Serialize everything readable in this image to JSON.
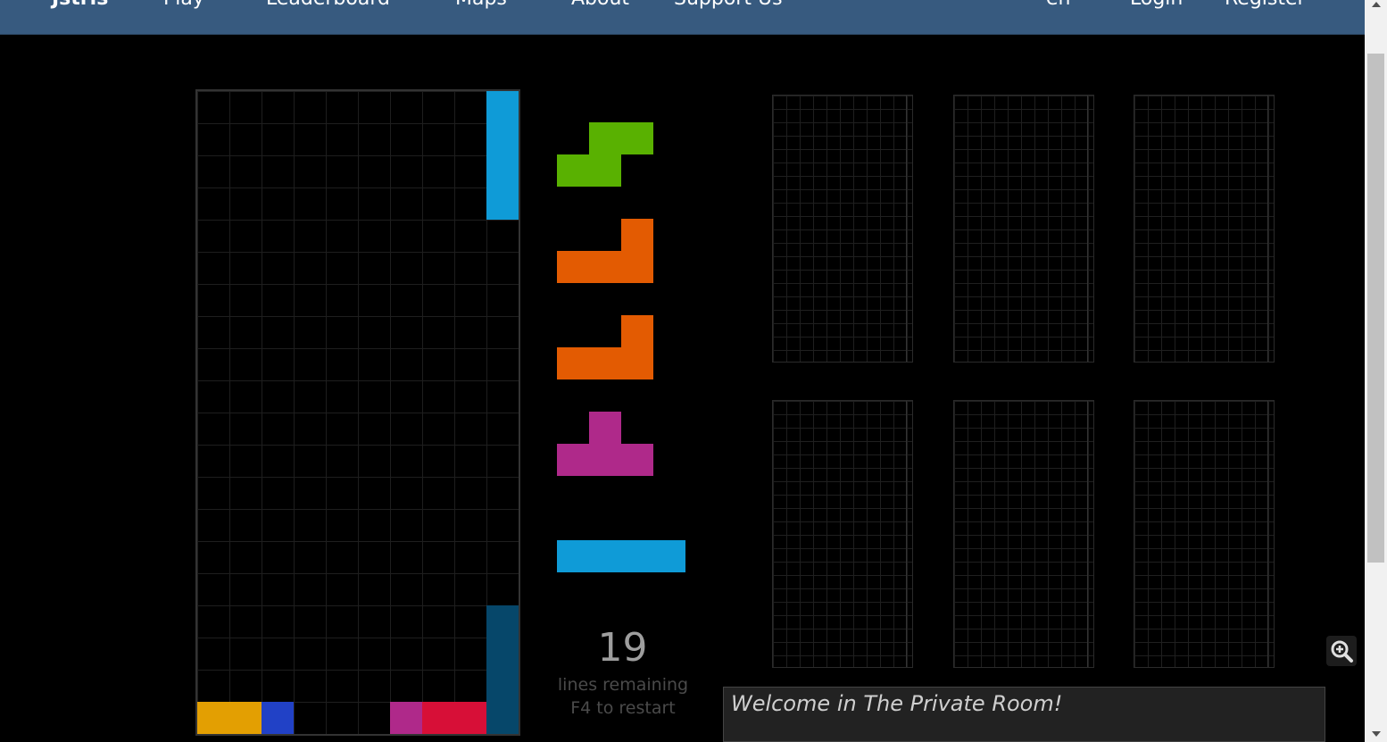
{
  "nav": {
    "brand": "Jstris",
    "items": [
      "Play",
      "Leaderboard",
      "Maps",
      "About",
      "Support Us"
    ],
    "language": "en",
    "login": "Login",
    "register": "Register"
  },
  "colors": {
    "navbar": "#375a7f",
    "I": "#0f9bd7",
    "I_dark": "#06476a",
    "S": "#59b101",
    "L": "#e35b02",
    "T": "#af298a",
    "O": "#e39f02",
    "J": "#2141c6",
    "Z": "#d70f37"
  },
  "board": {
    "columns": 10,
    "rows": 20,
    "cells": [
      {
        "col": 9,
        "row": 0,
        "piece": "I"
      },
      {
        "col": 9,
        "row": 1,
        "piece": "I"
      },
      {
        "col": 9,
        "row": 2,
        "piece": "I"
      },
      {
        "col": 9,
        "row": 3,
        "piece": "I"
      },
      {
        "col": 9,
        "row": 16,
        "piece": "I_dark"
      },
      {
        "col": 9,
        "row": 17,
        "piece": "I_dark"
      },
      {
        "col": 9,
        "row": 18,
        "piece": "I_dark"
      },
      {
        "col": 9,
        "row": 19,
        "piece": "I_dark"
      },
      {
        "col": 0,
        "row": 19,
        "piece": "O"
      },
      {
        "col": 1,
        "row": 19,
        "piece": "O"
      },
      {
        "col": 2,
        "row": 19,
        "piece": "J"
      },
      {
        "col": 6,
        "row": 19,
        "piece": "T"
      },
      {
        "col": 7,
        "row": 19,
        "piece": "Z"
      },
      {
        "col": 8,
        "row": 19,
        "piece": "Z"
      }
    ]
  },
  "queue": [
    "S",
    "L",
    "L",
    "T",
    "I"
  ],
  "stats": {
    "lines_remaining": "19",
    "lines_label": "lines remaining",
    "restart_hint": "F4 to restart"
  },
  "opponents": {
    "count": 6
  },
  "chat": {
    "welcome": "Welcome in The Private Room!"
  }
}
